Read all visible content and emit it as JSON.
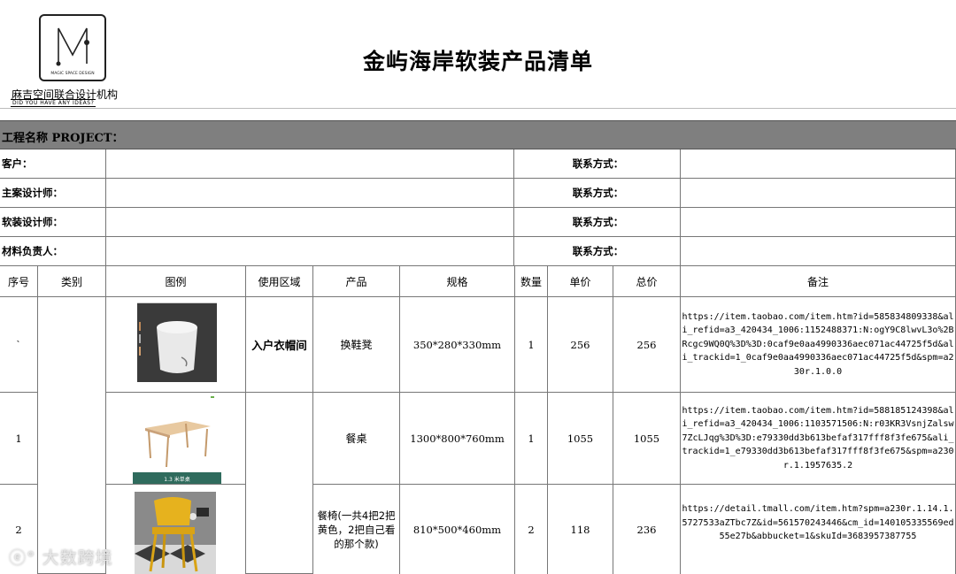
{
  "logo": {
    "company": "麻吉空间联合设计机构",
    "tagline": "DID YOU HAVE ANY IDEAS?",
    "mark_text": "MAGIC SPACE DESIGN"
  },
  "title": "金屿海岸软装产品清单",
  "project_label": "工程名称 PROJECT：",
  "info_rows": [
    {
      "label": "客户：",
      "contact_label": "联系方式："
    },
    {
      "label": "主案设计师：",
      "contact_label": "联系方式："
    },
    {
      "label": "软装设计师：",
      "contact_label": "联系方式："
    },
    {
      "label": "材料负责人：",
      "contact_label": "联系方式："
    }
  ],
  "columns": [
    "序号",
    "类别",
    "图例",
    "使用区域",
    "产品",
    "规格",
    "数量",
    "单价",
    "总价",
    "备注"
  ],
  "rows": [
    {
      "index": "`",
      "area": "入户衣帽间",
      "product": "换鞋凳",
      "spec": "350*280*330mm",
      "qty": "1",
      "unit_price": "256",
      "total": "256",
      "note": "https://item.taobao.com/item.htm?id=585834809338&ali_refid=a3_420434_1006:1152488371:N:ogY9C8lwvL3o%2BRcgc9WQ0Q%3D%3D:0caf9e0aa4990336aec071ac44725f5d&ali_trackid=1_0caf9e0aa4990336aec071ac44725f5d&spm=a230r.1.0.0"
    },
    {
      "index": "1",
      "area": "",
      "product": "餐桌",
      "spec": "1300*800*760mm",
      "qty": "1",
      "unit_price": "1055",
      "total": "1055",
      "note": "https://item.taobao.com/item.htm?id=588185124398&ali_refid=a3_420434_1006:1103571506:N:r03KR3VsnjZalsw7ZcLJqg%3D%3D:e79330dd3b613befaf317fff8f3fe675&ali_trackid=1_e79330dd3b613befaf317fff8f3fe675&spm=a230r.1.1957635.2",
      "image_caption": "1.3 米单桌"
    },
    {
      "index": "2",
      "area": "",
      "product": "餐椅(一共4把2把黄色，2把自己看的那个款)",
      "spec": "810*500*460mm",
      "qty": "2",
      "unit_price": "118",
      "total": "236",
      "note": "https://detail.tmall.com/item.htm?spm=a230r.1.14.1.5727533aZTbc7Z&id=561570243446&cm_id=140105335569ed55e27b&abbucket=1&skuId=3683957387755"
    }
  ],
  "watermark": "大数跨境"
}
